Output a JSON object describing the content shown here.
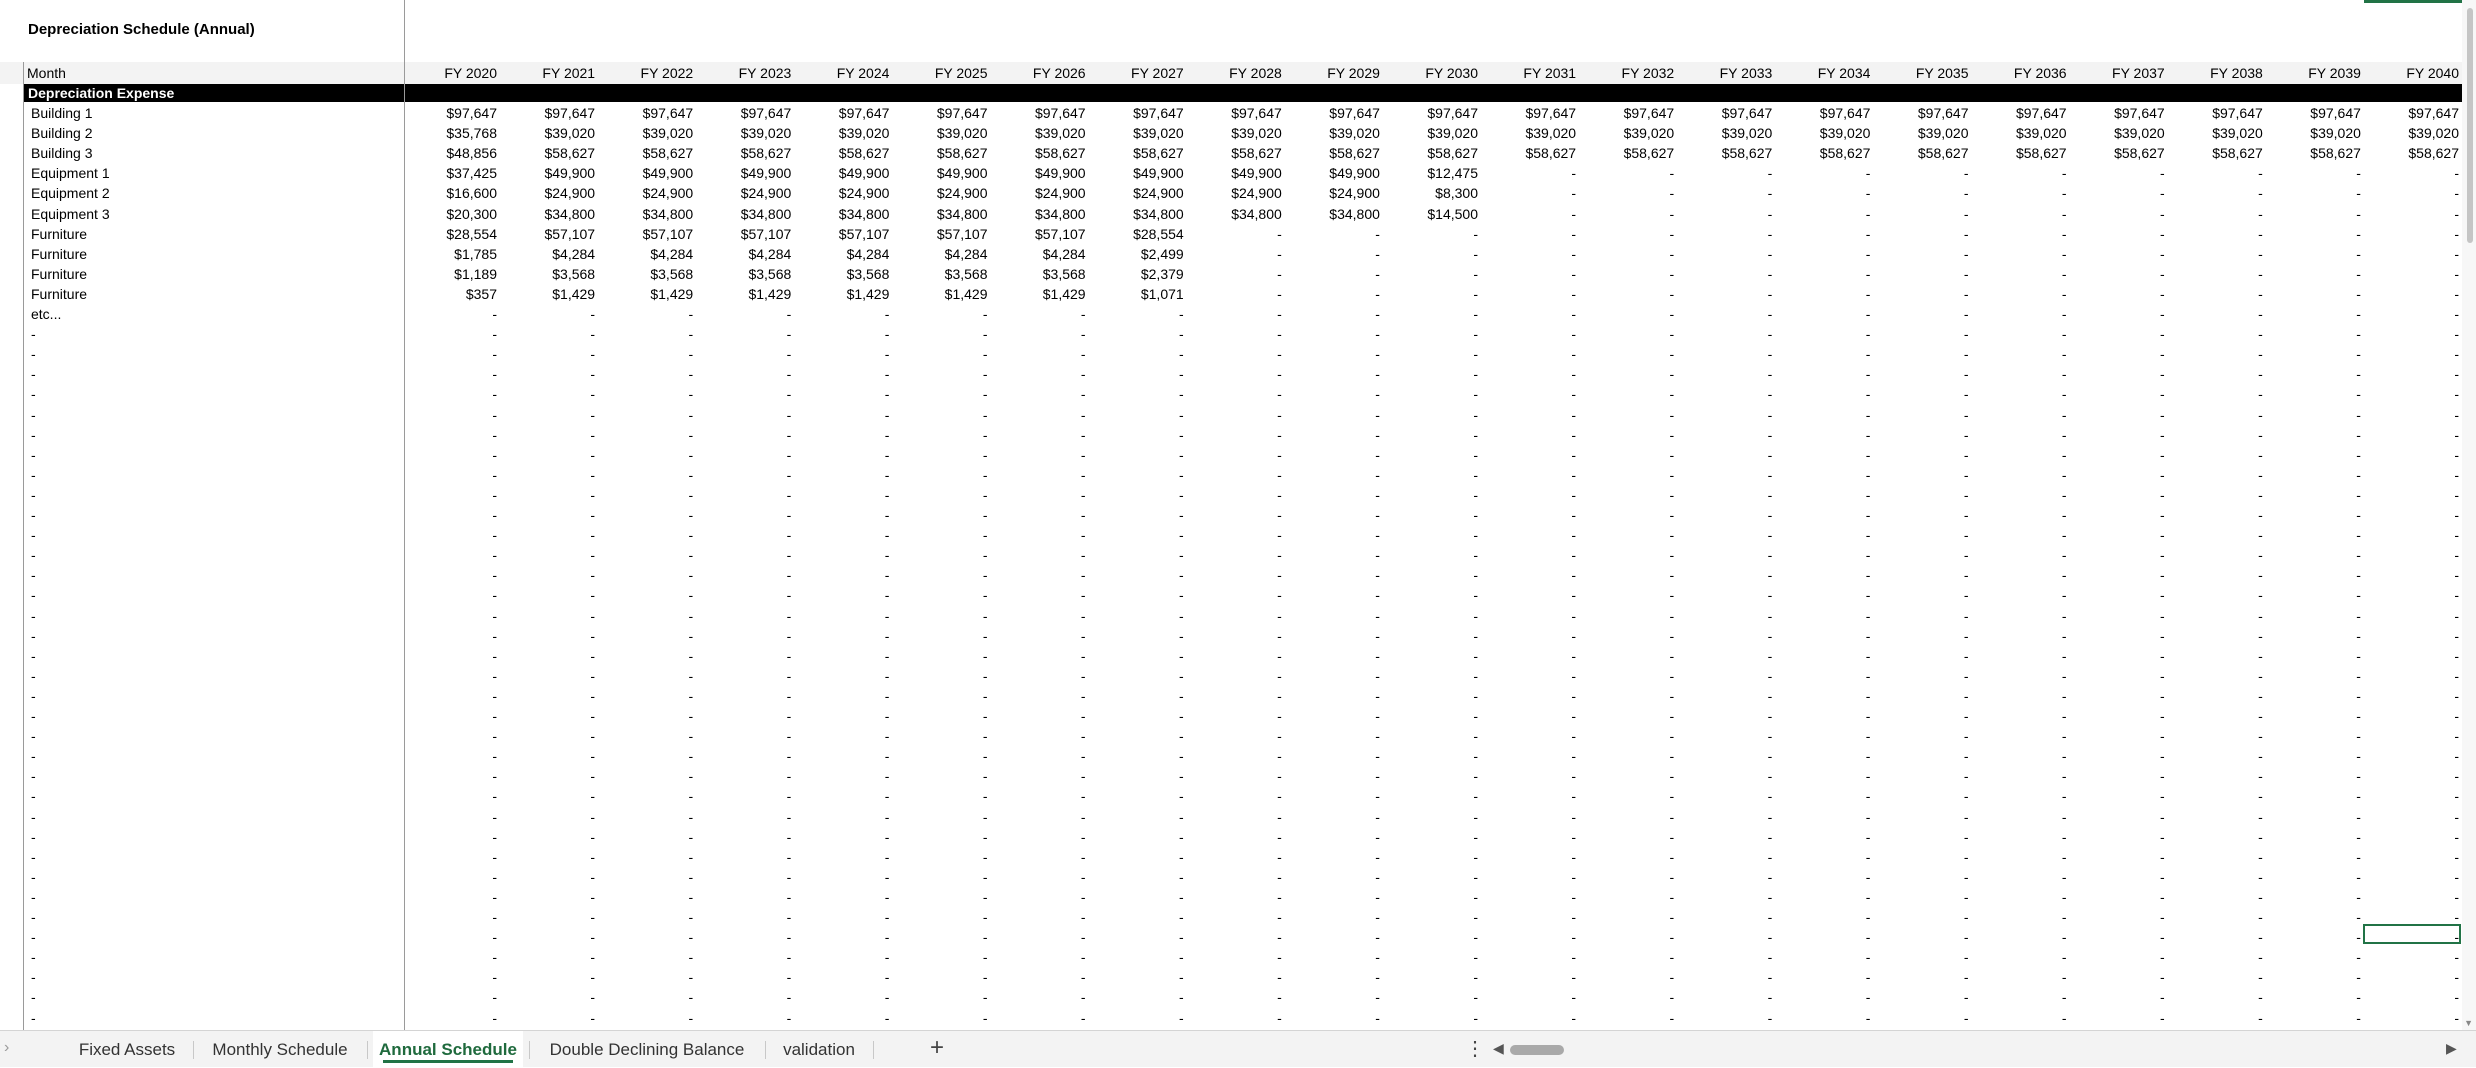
{
  "sheet": {
    "title": "Depreciation Schedule (Annual)",
    "header_label": "Month",
    "section_label": "Depreciation Expense",
    "years": [
      "FY 2020",
      "FY 2021",
      "FY 2022",
      "FY 2023",
      "FY 2024",
      "FY 2025",
      "FY 2026",
      "FY 2027",
      "FY 2028",
      "FY 2029",
      "FY 2030",
      "FY 2031",
      "FY 2032",
      "FY 2033",
      "FY 2034",
      "FY 2035",
      "FY 2036",
      "FY 2037",
      "FY 2038",
      "FY 2039",
      "FY 2040"
    ],
    "rows": [
      {
        "label": "Building 1",
        "values": [
          "$97,647",
          "$97,647",
          "$97,647",
          "$97,647",
          "$97,647",
          "$97,647",
          "$97,647",
          "$97,647",
          "$97,647",
          "$97,647",
          "$97,647",
          "$97,647",
          "$97,647",
          "$97,647",
          "$97,647",
          "$97,647",
          "$97,647",
          "$97,647",
          "$97,647",
          "$97,647",
          "$97,647"
        ]
      },
      {
        "label": "Building 2",
        "values": [
          "$35,768",
          "$39,020",
          "$39,020",
          "$39,020",
          "$39,020",
          "$39,020",
          "$39,020",
          "$39,020",
          "$39,020",
          "$39,020",
          "$39,020",
          "$39,020",
          "$39,020",
          "$39,020",
          "$39,020",
          "$39,020",
          "$39,020",
          "$39,020",
          "$39,020",
          "$39,020",
          "$39,020"
        ]
      },
      {
        "label": "Building 3",
        "values": [
          "$48,856",
          "$58,627",
          "$58,627",
          "$58,627",
          "$58,627",
          "$58,627",
          "$58,627",
          "$58,627",
          "$58,627",
          "$58,627",
          "$58,627",
          "$58,627",
          "$58,627",
          "$58,627",
          "$58,627",
          "$58,627",
          "$58,627",
          "$58,627",
          "$58,627",
          "$58,627",
          "$58,627"
        ]
      },
      {
        "label": "Equipment 1",
        "values": [
          "$37,425",
          "$49,900",
          "$49,900",
          "$49,900",
          "$49,900",
          "$49,900",
          "$49,900",
          "$49,900",
          "$49,900",
          "$49,900",
          "$12,475",
          "-",
          "-",
          "-",
          "-",
          "-",
          "-",
          "-",
          "-",
          "-",
          "-"
        ]
      },
      {
        "label": "Equipment 2",
        "values": [
          "$16,600",
          "$24,900",
          "$24,900",
          "$24,900",
          "$24,900",
          "$24,900",
          "$24,900",
          "$24,900",
          "$24,900",
          "$24,900",
          "$8,300",
          "-",
          "-",
          "-",
          "-",
          "-",
          "-",
          "-",
          "-",
          "-",
          "-"
        ]
      },
      {
        "label": "Equipment 3",
        "values": [
          "$20,300",
          "$34,800",
          "$34,800",
          "$34,800",
          "$34,800",
          "$34,800",
          "$34,800",
          "$34,800",
          "$34,800",
          "$34,800",
          "$14,500",
          "-",
          "-",
          "-",
          "-",
          "-",
          "-",
          "-",
          "-",
          "-",
          "-"
        ]
      },
      {
        "label": "Furniture",
        "values": [
          "$28,554",
          "$57,107",
          "$57,107",
          "$57,107",
          "$57,107",
          "$57,107",
          "$57,107",
          "$28,554",
          "-",
          "-",
          "-",
          "-",
          "-",
          "-",
          "-",
          "-",
          "-",
          "-",
          "-",
          "-",
          "-"
        ]
      },
      {
        "label": "Furniture",
        "values": [
          "$1,785",
          "$4,284",
          "$4,284",
          "$4,284",
          "$4,284",
          "$4,284",
          "$4,284",
          "$2,499",
          "-",
          "-",
          "-",
          "-",
          "-",
          "-",
          "-",
          "-",
          "-",
          "-",
          "-",
          "-",
          "-"
        ]
      },
      {
        "label": "Furniture",
        "values": [
          "$1,189",
          "$3,568",
          "$3,568",
          "$3,568",
          "$3,568",
          "$3,568",
          "$3,568",
          "$2,379",
          "-",
          "-",
          "-",
          "-",
          "-",
          "-",
          "-",
          "-",
          "-",
          "-",
          "-",
          "-",
          "-"
        ]
      },
      {
        "label": "Furniture",
        "values": [
          "$357",
          "$1,429",
          "$1,429",
          "$1,429",
          "$1,429",
          "$1,429",
          "$1,429",
          "$1,071",
          "-",
          "-",
          "-",
          "-",
          "-",
          "-",
          "-",
          "-",
          "-",
          "-",
          "-",
          "-",
          "-"
        ]
      },
      {
        "label": "etc...",
        "values": [
          "-",
          "-",
          "-",
          "-",
          "-",
          "-",
          "-",
          "-",
          "-",
          "-",
          "-",
          "-",
          "-",
          "-",
          "-",
          "-",
          "-",
          "-",
          "-",
          "-",
          "-"
        ]
      }
    ],
    "blank_row_label": "-",
    "blank_cell_value": "-",
    "blank_row_count": 35,
    "selected_cell_value": "-",
    "accent_color": "#217346"
  },
  "tabs": [
    {
      "label": "Fixed Assets",
      "active": false
    },
    {
      "label": "Monthly Schedule",
      "active": false
    },
    {
      "label": "Annual Schedule",
      "active": true
    },
    {
      "label": "Double Declining Balance",
      "active": false
    },
    {
      "label": "validation",
      "active": false
    }
  ],
  "controls": {
    "add_sheet_icon": "+",
    "more_icon": "⋮",
    "scroll_left_icon": "◀",
    "scroll_right_icon": "▶",
    "nav_prev_icon": "›"
  }
}
